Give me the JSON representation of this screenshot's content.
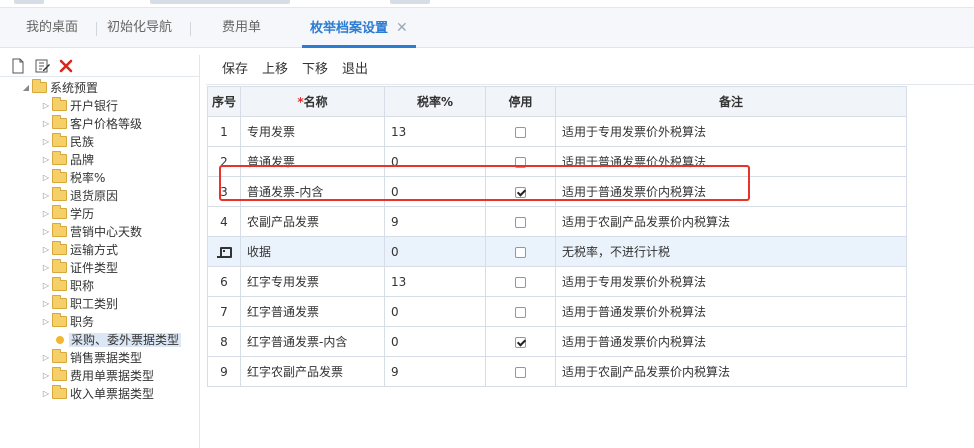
{
  "tabs": [
    {
      "label": "我的桌面"
    },
    {
      "label": "初始化导航"
    },
    {
      "label": "费用单"
    },
    {
      "label": "枚举档案设置",
      "close": "✕"
    }
  ],
  "left_toolbar": {
    "icons": [
      "new-doc-icon",
      "edit-icon",
      "delete-icon"
    ]
  },
  "tree": {
    "root": "系统预置",
    "children": [
      "开户银行",
      "客户价格等级",
      "民族",
      "品牌",
      "税率%",
      "退货原因",
      "学历",
      "营销中心天数",
      "运输方式",
      "证件类型",
      "职称",
      "职工类别",
      "职务",
      "采购、委外票据类型",
      "销售票据类型",
      "费用单票据类型",
      "收入单票据类型"
    ],
    "selected": "采购、委外票据类型"
  },
  "toolbar": {
    "save": "保存",
    "up": "上移",
    "down": "下移",
    "exit": "退出"
  },
  "grid": {
    "headers": {
      "no": "序号",
      "required_mark": "*",
      "name": "名称",
      "rate": "税率%",
      "disabled": "停用",
      "remark": "备注"
    },
    "rows": [
      {
        "no": "1",
        "name": "专用发票",
        "rate": "13",
        "disabled": false,
        "remark": "适用于专用发票价外税算法"
      },
      {
        "no": "2",
        "name": "普通发票",
        "rate": "0",
        "disabled": false,
        "remark": "适用于普通发票价外税算法"
      },
      {
        "no": "3",
        "name": "普通发票-内含",
        "rate": "0",
        "disabled": true,
        "remark": "适用于普通发票价内税算法"
      },
      {
        "no": "4",
        "name": "农副产品发票",
        "rate": "9",
        "disabled": false,
        "remark": "适用于农副产品发票价内税算法"
      },
      {
        "no": "",
        "name": "收据",
        "rate": "0",
        "disabled": false,
        "remark": "无税率，不进行计税",
        "editing": true
      },
      {
        "no": "6",
        "name": "红字专用发票",
        "rate": "13",
        "disabled": false,
        "remark": "适用于专用发票价外税算法"
      },
      {
        "no": "7",
        "name": "红字普通发票",
        "rate": "0",
        "disabled": false,
        "remark": "适用于普通发票价外税算法"
      },
      {
        "no": "8",
        "name": "红字普通发票-内含",
        "rate": "0",
        "disabled": true,
        "remark": "适用于普通发票价内税算法"
      },
      {
        "no": "9",
        "name": "红字农副产品发票",
        "rate": "9",
        "disabled": false,
        "remark": "适用于农副产品发票价内税算法"
      }
    ]
  },
  "colors": {
    "accent": "#2b7cd3",
    "highlight_box": "#e8332a",
    "selected_row": "#eaf2fb"
  }
}
